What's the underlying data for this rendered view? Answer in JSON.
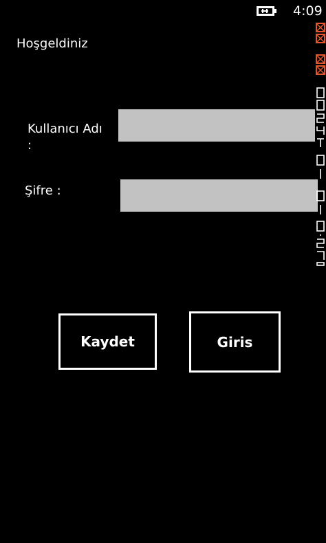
{
  "status_bar": {
    "time": "4:09",
    "battery_icon": "battery-charging-icon"
  },
  "page": {
    "welcome": "Hoşgeldiniz"
  },
  "form": {
    "username_label": "Kullanıcı Adı :",
    "password_label": "Şifre :",
    "username_value": "",
    "password_value": ""
  },
  "buttons": {
    "save_label": "Kaydet",
    "login_label": "Giris"
  },
  "colors": {
    "background": "#000000",
    "text": "#ffffff",
    "field_fill": "#c2c2c2",
    "debug_accent": "#e2572b"
  }
}
